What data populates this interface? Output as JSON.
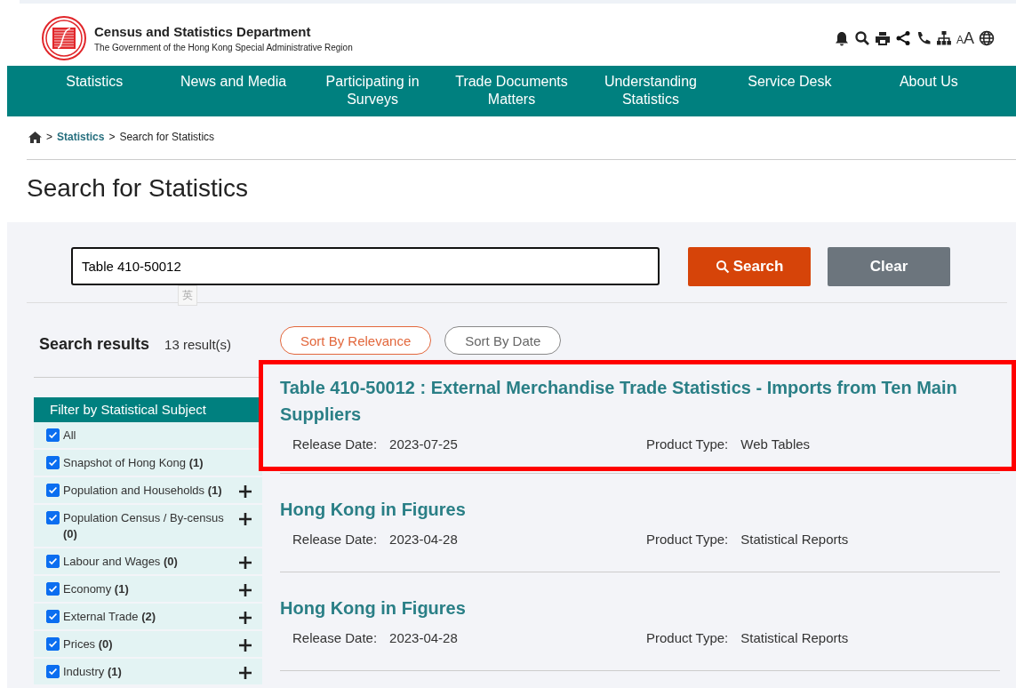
{
  "header": {
    "title": "Census and Statistics Department",
    "subtitle": "The Government of the Hong Kong Special Administrative Region",
    "font_size_label_small": "A",
    "font_size_label_large": "A"
  },
  "nav": [
    "Statistics",
    "News and Media",
    "Participating in Surveys",
    "Trade Documents Matters",
    "Understanding Statistics",
    "Service Desk",
    "About Us"
  ],
  "breadcrumb": [
    {
      "separator": ">",
      "label": "Statistics",
      "link": true
    },
    {
      "separator": ">",
      "label": "Search for Statistics",
      "link": false
    }
  ],
  "page_title": "Search for Statistics",
  "search": {
    "value": "Table 410-50012",
    "ime_indicator": "英",
    "search_button": "Search",
    "clear_button": "Clear"
  },
  "results_heading": "Search results",
  "results_count": "13 result(s)",
  "sort": [
    {
      "label": "Sort By Relevance",
      "selected": true
    },
    {
      "label": "Sort By Date",
      "selected": false
    }
  ],
  "filter": {
    "title": "Filter by Statistical Subject",
    "items": [
      {
        "label": "All",
        "checked": true,
        "expandable": false
      },
      {
        "label": "Snapshot of Hong Kong",
        "count": "(1)",
        "checked": true,
        "expandable": false
      },
      {
        "label": "Population and Households",
        "count": "(1)",
        "checked": true,
        "expandable": true
      },
      {
        "label": "Population Census / By-census",
        "count": "(0)",
        "checked": true,
        "expandable": true
      },
      {
        "label": "Labour and Wages",
        "count": "(0)",
        "checked": true,
        "expandable": true
      },
      {
        "label": "Economy",
        "count": "(1)",
        "checked": true,
        "expandable": true
      },
      {
        "label": "External Trade",
        "count": "(2)",
        "checked": true,
        "expandable": true
      },
      {
        "label": "Prices",
        "count": "(0)",
        "checked": true,
        "expandable": true
      },
      {
        "label": "Industry",
        "count": "(1)",
        "checked": true,
        "expandable": true
      }
    ]
  },
  "results": [
    {
      "title": "Table 410-50012 : External Merchandise Trade Statistics - Imports from Ten Main Suppliers",
      "release_label": "Release Date:",
      "release_date": "2023-07-25",
      "type_label": "Product Type:",
      "product_type": "Web Tables",
      "highlighted": true
    },
    {
      "title": "Hong Kong in Figures",
      "release_label": "Release Date:",
      "release_date": "2023-04-28",
      "type_label": "Product Type:",
      "product_type": "Statistical Reports",
      "highlighted": false
    },
    {
      "title": "Hong Kong in Figures",
      "release_label": "Release Date:",
      "release_date": "2023-04-28",
      "type_label": "Product Type:",
      "product_type": "Statistical Reports",
      "highlighted": false
    }
  ]
}
